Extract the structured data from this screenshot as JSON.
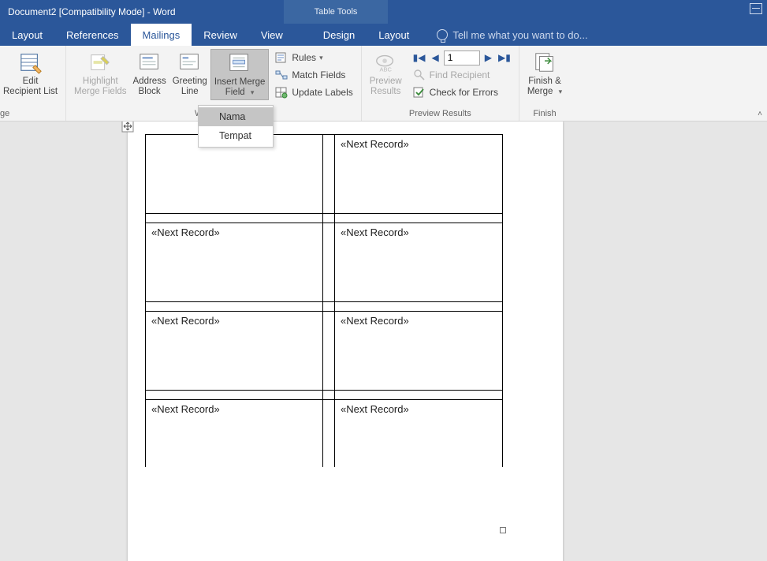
{
  "title": "Document2 [Compatibility Mode] - Word",
  "tools_tab": "Table Tools",
  "tabs": {
    "layout1": "Layout",
    "references": "References",
    "mailings": "Mailings",
    "review": "Review",
    "view": "View",
    "design": "Design",
    "layout2": "Layout"
  },
  "tellme": "Tell me what you want to do...",
  "ribbon": {
    "edit_recipient_list": "Edit\nRecipient List",
    "highlight_merge_fields": "Highlight\nMerge Fields",
    "address_block": "Address\nBlock",
    "greeting_line": "Greeting\nLine",
    "insert_merge_field": "Insert Merge\nField",
    "rules": "Rules",
    "match_fields": "Match Fields",
    "update_labels": "Update Labels",
    "preview_results": "Preview\nResults",
    "find_recipient": "Find Recipient",
    "check_errors": "Check for Errors",
    "finish_merge": "Finish &\nMerge",
    "record_value": "1"
  },
  "groups": {
    "truncated_left": "ge",
    "write_insert": "Write & In",
    "preview": "Preview Results",
    "finish": "Finish"
  },
  "dropdown": {
    "items": [
      "Nama",
      "Tempat"
    ]
  },
  "document": {
    "next_record": "«Next Record»"
  }
}
